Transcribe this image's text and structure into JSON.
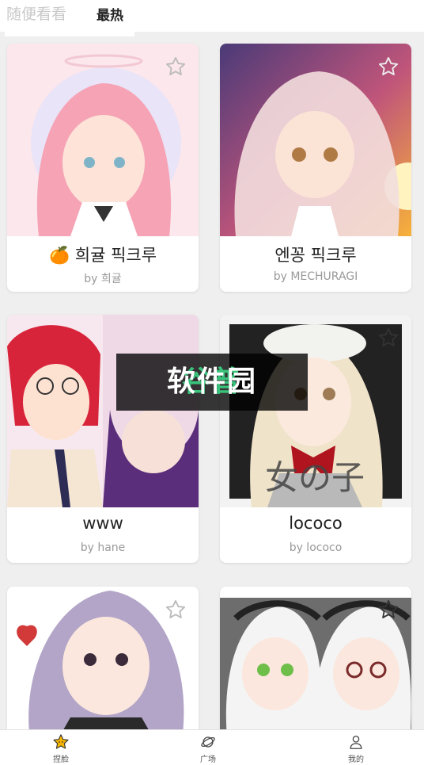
{
  "tabs": {
    "random": "随便看看",
    "hot": "最热"
  },
  "cards": [
    {
      "title": "🍊 희귤 픽크루",
      "author": "by 희귤"
    },
    {
      "title": "엔꽁 픽크루",
      "author": "by MECHURAGI"
    },
    {
      "title": "www",
      "author": "by hane"
    },
    {
      "title": "lococo",
      "author": "by lococo"
    },
    {
      "title": "",
      "author": ""
    },
    {
      "title": "",
      "author": ""
    }
  ],
  "watermark": {
    "part1": "谷普",
    "part2": "软件园"
  },
  "nav": [
    {
      "label": "捏脸",
      "icon": "star-face-icon"
    },
    {
      "label": "广场",
      "icon": "planet-icon"
    },
    {
      "label": "我的",
      "icon": "person-icon"
    }
  ],
  "colors": {
    "accent": "#f5b400",
    "watermark_green": "#39c27a"
  }
}
